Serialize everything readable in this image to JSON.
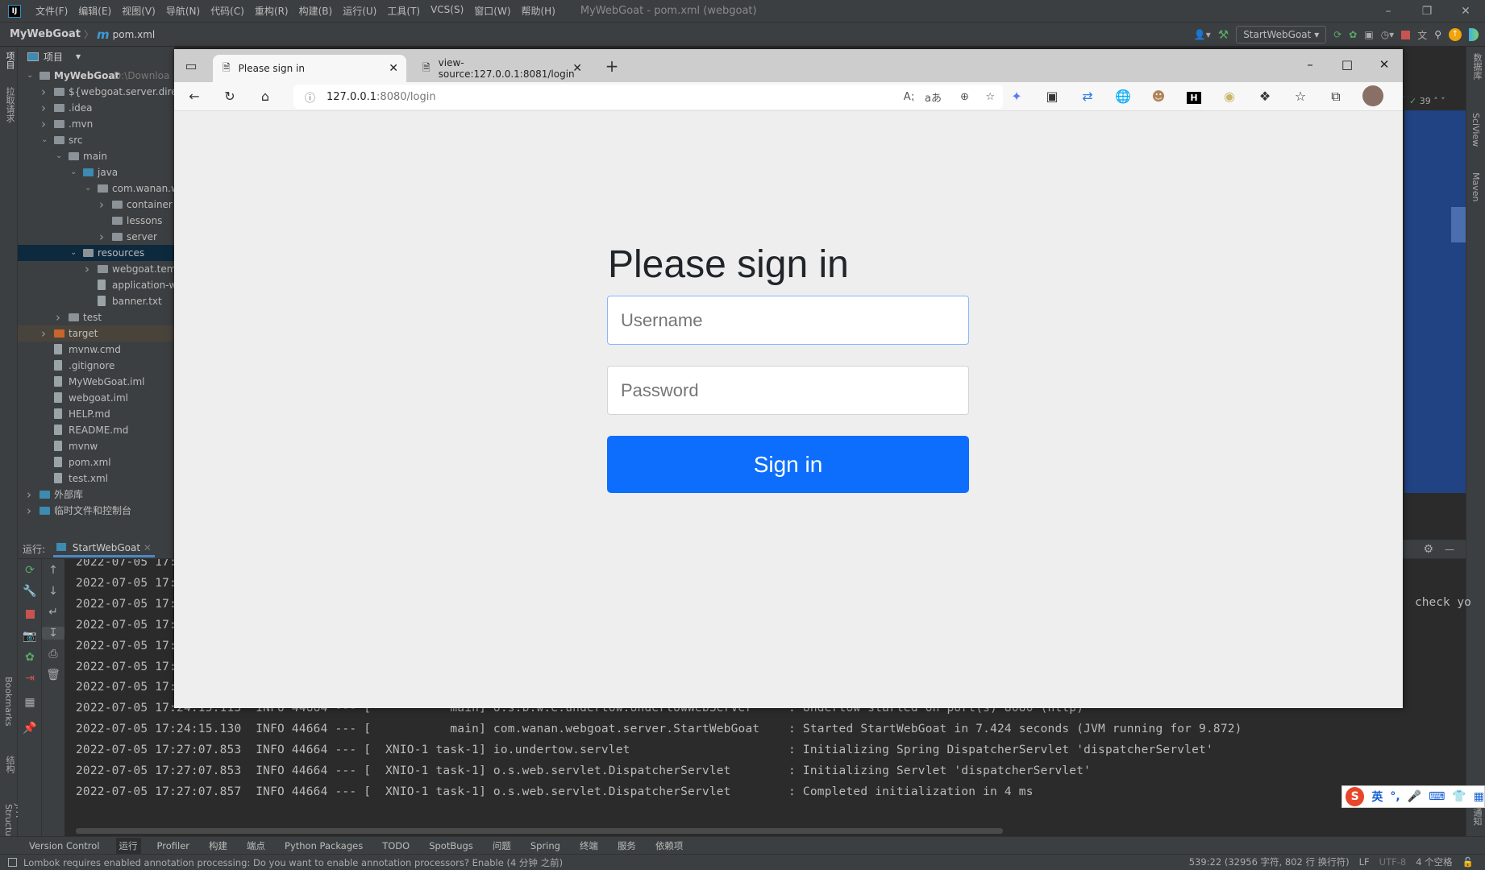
{
  "ide": {
    "menu": [
      "文件(F)",
      "编辑(E)",
      "视图(V)",
      "导航(N)",
      "代码(C)",
      "重构(R)",
      "构建(B)",
      "运行(U)",
      "工具(T)",
      "VCS(S)",
      "窗口(W)",
      "帮助(H)"
    ],
    "window_title": "MyWebGoat - pom.xml (webgoat)",
    "breadcrumb": {
      "project": "MyWebGoat",
      "file": "pom.xml"
    },
    "run_config": "StartWebGoat",
    "project_panel": {
      "title": "项目",
      "items": [
        {
          "level": 0,
          "chev": "down",
          "icon": "module",
          "label": "MyWebGoat",
          "suffix": "D:\\Downloa"
        },
        {
          "level": 1,
          "chev": "right",
          "icon": "folder",
          "label": "${webgoat.server.direc"
        },
        {
          "level": 1,
          "chev": "right",
          "icon": "folder",
          "label": ".idea"
        },
        {
          "level": 1,
          "chev": "right",
          "icon": "folder",
          "label": ".mvn"
        },
        {
          "level": 1,
          "chev": "down",
          "icon": "folder",
          "label": "src"
        },
        {
          "level": 2,
          "chev": "down",
          "icon": "folder",
          "label": "main"
        },
        {
          "level": 3,
          "chev": "down",
          "icon": "folder-blue",
          "label": "java"
        },
        {
          "level": 4,
          "chev": "down",
          "icon": "package",
          "label": "com.wanan.w"
        },
        {
          "level": 5,
          "chev": "right",
          "icon": "package",
          "label": "container"
        },
        {
          "level": 5,
          "chev": "",
          "icon": "package",
          "label": "lessons"
        },
        {
          "level": 5,
          "chev": "right",
          "icon": "package",
          "label": "server"
        },
        {
          "level": 3,
          "chev": "down",
          "icon": "folder-res",
          "label": "resources",
          "selected": true
        },
        {
          "level": 4,
          "chev": "right",
          "icon": "folder",
          "label": "webgoat.temp"
        },
        {
          "level": 4,
          "chev": "",
          "icon": "spring-file",
          "label": "application-w"
        },
        {
          "level": 4,
          "chev": "",
          "icon": "text-file",
          "label": "banner.txt"
        },
        {
          "level": 2,
          "chev": "right",
          "icon": "folder",
          "label": "test"
        },
        {
          "level": 1,
          "chev": "right",
          "icon": "folder-orange",
          "label": "target",
          "highlight": true
        },
        {
          "level": 1,
          "chev": "",
          "icon": "cmd-file",
          "label": "mvnw.cmd"
        },
        {
          "level": 1,
          "chev": "",
          "icon": "file",
          "label": ".gitignore"
        },
        {
          "level": 1,
          "chev": "",
          "icon": "file",
          "label": "MyWebGoat.iml"
        },
        {
          "level": 1,
          "chev": "",
          "icon": "file",
          "label": "webgoat.iml"
        },
        {
          "level": 1,
          "chev": "",
          "icon": "md-file",
          "label": "HELP.md"
        },
        {
          "level": 1,
          "chev": "",
          "icon": "md-file",
          "label": "README.md"
        },
        {
          "level": 1,
          "chev": "",
          "icon": "shell-file",
          "label": "mvnw"
        },
        {
          "level": 1,
          "chev": "",
          "icon": "maven-file",
          "label": "pom.xml"
        },
        {
          "level": 1,
          "chev": "",
          "icon": "xml-file",
          "label": "test.xml"
        },
        {
          "level": 0,
          "chev": "right",
          "icon": "library",
          "label": "外部库"
        },
        {
          "level": 0,
          "chev": "right",
          "icon": "scratch",
          "label": "临时文件和控制台"
        }
      ]
    },
    "left_strip": [
      "项目",
      "拉取请求",
      "Bookmarks",
      "结构",
      "JPA Structure"
    ],
    "right_strip": [
      "数据库",
      "SciView",
      "Maven",
      "通知"
    ],
    "inspection_count": "39",
    "run_panel": {
      "label": "运行:",
      "tab": "StartWebGoat",
      "lines": [
        "2022-07-05 17:",
        "2022-07-05 17:",
        "2022-07-05 17:",
        "2022-07-05 17:",
        "2022-07-05 17:",
        "2022-07-05 17:",
        "2022-07-05 17:",
        "2022-07-05 17:24:15.113  INFO 44664 --- [           main] o.s.b.w.e.undertow.UndertowWebServer     : Undertow started on port(s) 8080 (http)",
        "2022-07-05 17:24:15.130  INFO 44664 --- [           main] com.wanan.webgoat.server.StartWebGoat    : Started StartWebGoat in 7.424 seconds (JVM running for 9.872)",
        "2022-07-05 17:27:07.853  INFO 44664 --- [  XNIO-1 task-1] io.undertow.servlet                      : Initializing Spring DispatcherServlet 'dispatcherServlet'",
        "2022-07-05 17:27:07.853  INFO 44664 --- [  XNIO-1 task-1] o.s.web.servlet.DispatcherServlet        : Initializing Servlet 'dispatcherServlet'",
        "2022-07-05 17:27:07.857  INFO 44664 --- [  XNIO-1 task-1] o.s.web.servlet.DispatcherServlet        : Completed initialization in 4 ms"
      ],
      "right_fragment": "check yo"
    },
    "bottom_tools": [
      "Version Control",
      "运行",
      "Profiler",
      "构建",
      "端点",
      "Python Packages",
      "TODO",
      "SpotBugs",
      "问题",
      "Spring",
      "终端",
      "服务",
      "依赖项"
    ],
    "active_bottom_tool": "运行",
    "status": {
      "message": "Lombok requires enabled annotation processing: Do you want to enable annotation processors? Enable (4 分钟 之前)",
      "position": "539:22 (32956 字符, 802 行 换行符)",
      "line_sep": "LF",
      "encoding": "UTF-8",
      "indent": "4 个空格"
    },
    "ime": {
      "mode": "英"
    }
  },
  "browser": {
    "tabs": [
      {
        "title": "Please sign in",
        "active": true
      },
      {
        "title": "view-source:127.0.0.1:8081/login",
        "active": false
      }
    ],
    "url": {
      "host": "127.0.0.1",
      "rest": ":8080/login"
    },
    "page": {
      "heading": "Please sign in",
      "username_placeholder": "Username",
      "password_placeholder": "Password",
      "submit": "Sign in"
    },
    "colors": {
      "primary": "#0d6efd",
      "background": "#eeeeee"
    }
  }
}
